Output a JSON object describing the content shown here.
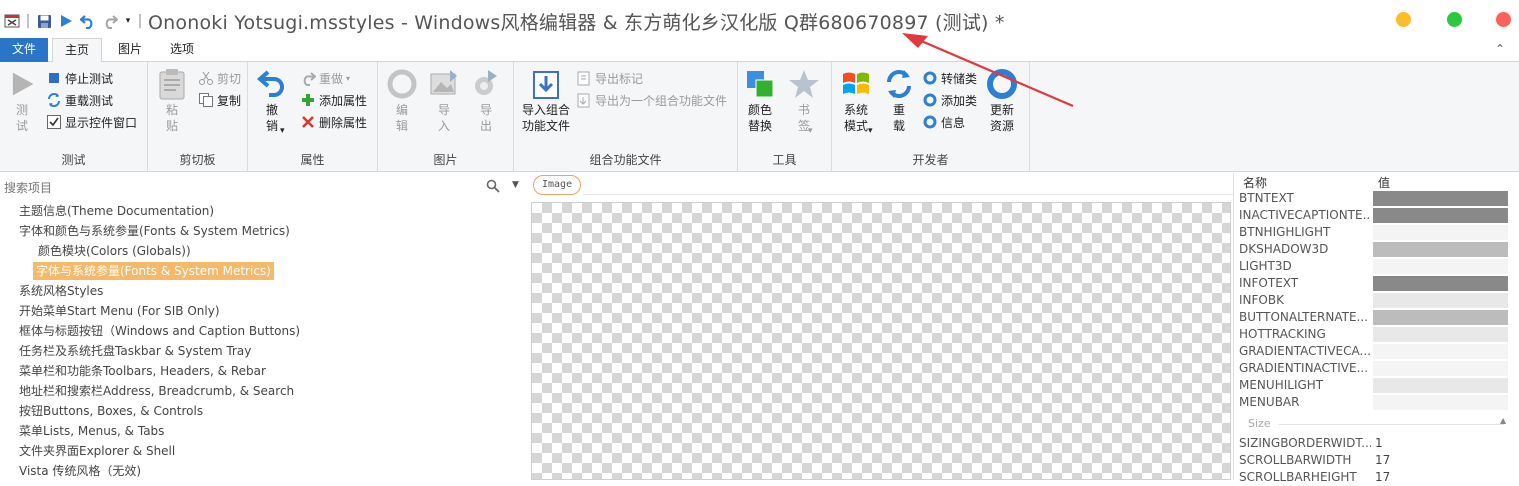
{
  "window": {
    "title": "Ononoki Yotsugi.msstyles - Windows风格编辑器 & 东方萌化乡汉化版 Q群680670897 (测试) *"
  },
  "qat": {
    "icons": [
      "app-icon",
      "save-icon",
      "play-icon",
      "undo-icon",
      "redo-icon",
      "customize-icon"
    ]
  },
  "traffic_lights": {
    "colors": [
      "#fbbd2c",
      "#2dc840",
      "#fc605b"
    ]
  },
  "tabs": [
    {
      "label": "文件"
    },
    {
      "label": "主页"
    },
    {
      "label": "图片"
    },
    {
      "label": "选项"
    }
  ],
  "ribbon": {
    "test_group": {
      "label": "测试",
      "test_button": "测\n试",
      "stop_test": "停止测试",
      "reload_test": "重载测试",
      "show_controls_window": "显示控件窗口"
    },
    "clipboard_group": {
      "label": "剪切板",
      "paste": "粘\n贴",
      "cut": "剪切",
      "copy": "复制"
    },
    "properties_group": {
      "label": "属性",
      "undo": "撤\n销",
      "redo": "重做",
      "add_property": "添加属性",
      "delete_property": "删除属性"
    },
    "image_group": {
      "label": "图片",
      "edit": "编\n辑",
      "import": "导\n入",
      "export": "导\n出"
    },
    "aggregate_group": {
      "label": "组合功能文件",
      "import_aggregate": "导入组合\n功能文件",
      "export_marked": "导出标记",
      "export_as_aggregate": "导出为一个组合功能文件"
    },
    "tools_group": {
      "label": "工具",
      "color_replace": "颜色\n替换",
      "bookmark": "书\n签"
    },
    "developer_group": {
      "label": "开发者",
      "system_mode": "系统\n模式",
      "reload": "重\n载",
      "dump_classes": "转储类",
      "add_class": "添加类",
      "info": "信息",
      "update_resources": "更新\n资源"
    }
  },
  "tree": {
    "search_placeholder": "搜索项目",
    "items": [
      {
        "label": "主题信息(Theme Documentation)",
        "level": 0,
        "selected": false
      },
      {
        "label": "字体和颜色与系统参量(Fonts & System Metrics)",
        "level": 0,
        "selected": false
      },
      {
        "label": "颜色模块(Colors (Globals))",
        "level": 1,
        "selected": false
      },
      {
        "label": "字体与系统参量(Fonts & System Metrics)",
        "level": 1,
        "selected": true
      },
      {
        "label": "系统风格Styles",
        "level": 0,
        "selected": false
      },
      {
        "label": "开始菜单Start Menu (For SIB Only)",
        "level": 0,
        "selected": false
      },
      {
        "label": "框体与标题按钮（Windows and Caption Buttons)",
        "level": 0,
        "selected": false
      },
      {
        "label": "任务栏及系统托盘Taskbar & System Tray",
        "level": 0,
        "selected": false
      },
      {
        "label": "菜单栏和功能条Toolbars, Headers, & Rebar",
        "level": 0,
        "selected": false
      },
      {
        "label": "地址栏和搜索栏Address, Breadcrumb, & Search",
        "level": 0,
        "selected": false
      },
      {
        "label": "按钮Buttons, Boxes, & Controls",
        "level": 0,
        "selected": false
      },
      {
        "label": "菜单Lists, Menus, & Tabs",
        "level": 0,
        "selected": false
      },
      {
        "label": "文件夹界面Explorer & Shell",
        "level": 0,
        "selected": false
      },
      {
        "label": "Vista 传统风格（无效)",
        "level": 0,
        "selected": false
      }
    ]
  },
  "center": {
    "image_label": "Image"
  },
  "properties": {
    "header_name": "名称",
    "header_value": "值",
    "color_rows": [
      {
        "name": "BTNTEXT",
        "color": "#898989"
      },
      {
        "name": "INACTIVECAPTIONTE...",
        "color": "#898989"
      },
      {
        "name": "BTNHIGHLIGHT",
        "color": "#f4f4f4"
      },
      {
        "name": "DKSHADOW3D",
        "color": "#bcbcbc"
      },
      {
        "name": "LIGHT3D",
        "color": "#f4f4f4"
      },
      {
        "name": "INFOTEXT",
        "color": "#898989"
      },
      {
        "name": "INFOBK",
        "color": "#e8e8e8"
      },
      {
        "name": "BUTTONALTERNATE...",
        "color": "#bcbcbc"
      },
      {
        "name": "HOTTRACKING",
        "color": "#e8e8e8"
      },
      {
        "name": "GRADIENTACTIVECA...",
        "color": "#f4f4f4"
      },
      {
        "name": "GRADIENTINACTIVE...",
        "color": "#f4f4f4"
      },
      {
        "name": "MENUHILIGHT",
        "color": "#e8e8e8"
      },
      {
        "name": "MENUBAR",
        "color": "#f4f4f4"
      }
    ],
    "size_section_label": "Size",
    "size_rows": [
      {
        "name": "SIZINGBORDERWIDT...",
        "value": "1"
      },
      {
        "name": "SCROLLBARWIDTH",
        "value": "17"
      },
      {
        "name": "SCROLLBARHEIGHT",
        "value": "17"
      }
    ]
  }
}
